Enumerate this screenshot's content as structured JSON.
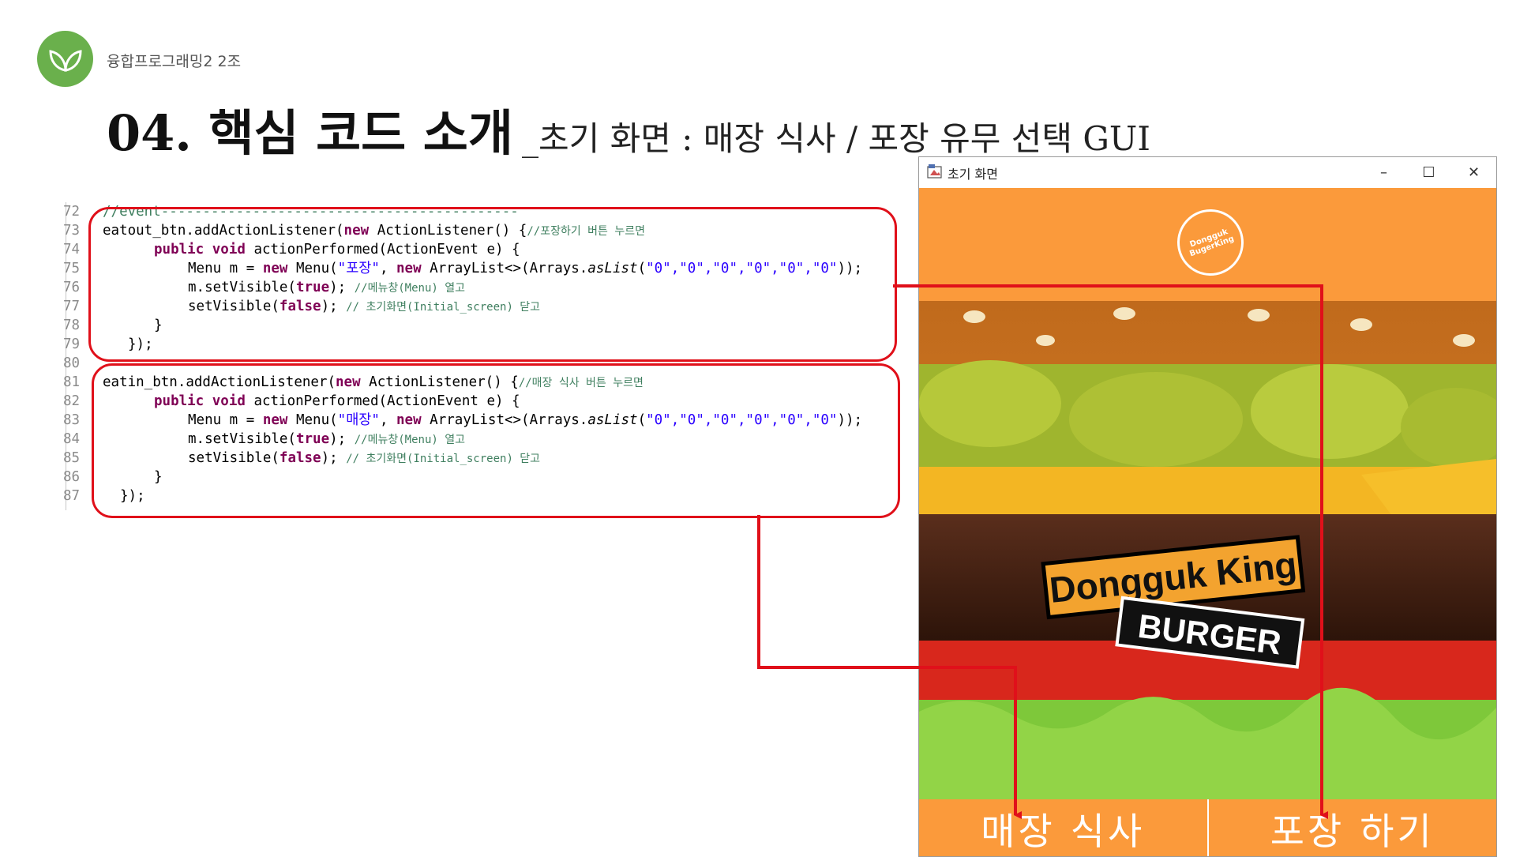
{
  "header": {
    "team": "융합프로그래밍2 2조",
    "title_main": "04. 핵심 코드 소개",
    "title_sub": "_초기 화면 : 매장 식사 / 포장 유무 선택 GUI"
  },
  "code": {
    "line_numbers": [
      "72",
      "73",
      "74",
      "75",
      "76",
      "77",
      "78",
      "79",
      "80",
      "81",
      "82",
      "83",
      "84",
      "85",
      "86",
      "87"
    ],
    "l72": "//event-------------------------------------------",
    "l73_a": "eatout_btn.addActionListener(",
    "l73_kw": "new",
    "l73_b": " ActionListener() {",
    "l73_c": "//포장하기 버튼 누르면",
    "l74_kw": "public void",
    "l74_b": " actionPerformed(ActionEvent e) {",
    "l75_a": "Menu m = ",
    "l75_kw": "new",
    "l75_b": " Menu(",
    "l75_str": "\"포장\"",
    "l75_c": ", ",
    "l75_kw2": "new",
    "l75_d": " ArrayList<>(Arrays.",
    "l75_it": "asList",
    "l75_e": "(",
    "l75_zeros": "\"0\",\"0\",\"0\",\"0\",\"0\",\"0\"",
    "l75_f": "));",
    "l76_a": "m.setVisible(",
    "l76_kw": "true",
    "l76_b": "); ",
    "l76_c": "//메뉴창(Menu) 열고",
    "l77_a": "setVisible(",
    "l77_kw": "false",
    "l77_b": "); ",
    "l77_c": "// 초기화면(Initial_screen) 닫고",
    "l78": "}",
    "l79": "});",
    "l81_a": "eatin_btn.addActionListener(",
    "l81_kw": "new",
    "l81_b": " ActionListener() {",
    "l81_c": "//매장 식사 버튼 누르면",
    "l82_kw": "public void",
    "l82_b": " actionPerformed(ActionEvent e) {",
    "l83_a": "Menu m = ",
    "l83_kw": "new",
    "l83_b": " Menu(",
    "l83_str": "\"매장\"",
    "l83_c": ", ",
    "l83_kw2": "new",
    "l83_d": " ArrayList<>(Arrays.",
    "l83_it": "asList",
    "l83_e": "(",
    "l83_zeros": "\"0\",\"0\",\"0\",\"0\",\"0\",\"0\"",
    "l83_f": "));",
    "l84_a": "m.setVisible(",
    "l84_kw": "true",
    "l84_b": "); ",
    "l84_c": "//메뉴창(Menu) 열고",
    "l85_a": "setVisible(",
    "l85_kw": "false",
    "l85_b": "); ",
    "l85_c": "// 초기화면(Initial_screen) 닫고",
    "l86": "}",
    "l87": "});"
  },
  "window": {
    "title": "초기 화면",
    "minimize": "–",
    "maximize": "☐",
    "close": "✕",
    "badge_text": "Dongguk BugerKing",
    "sign_main": "Dongguk King",
    "sign_sub": "BURGER",
    "eatin_label": "매장 식사",
    "eatout_label": "포장 하기"
  },
  "colors": {
    "accent_orange": "#fb9a3b",
    "box_red": "#e0101a",
    "logo_green": "#6ab04c"
  }
}
